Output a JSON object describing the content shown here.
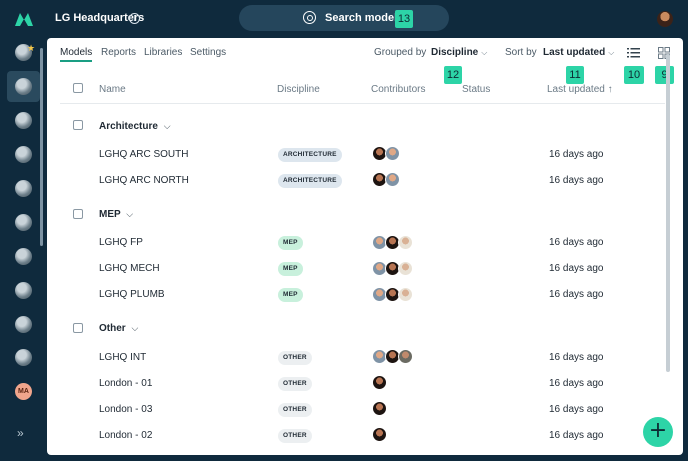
{
  "topbar": {
    "project_title": "LG Headquarters",
    "info_glyph": "i",
    "search_label": "Search models",
    "search_badge": "13"
  },
  "rail": {
    "user_initials": "MA",
    "expand_glyph": "»",
    "star_glyph": "★"
  },
  "tabs": [
    {
      "label": "Models",
      "active": true
    },
    {
      "label": "Reports",
      "active": false
    },
    {
      "label": "Libraries",
      "active": false
    },
    {
      "label": "Settings",
      "active": false
    }
  ],
  "toolbar": {
    "grouped_by_label": "Grouped by",
    "grouped_by_value": "Discipline",
    "grouped_by_badge": "12",
    "sort_by_label": "Sort by",
    "sort_by_value": "Last updated",
    "sort_by_badge": "11",
    "list_view_badge": "10",
    "grid_view_badge": "9",
    "chevron": "⌵"
  },
  "columns": {
    "name": "Name",
    "discipline": "Discipline",
    "contributors": "Contributors",
    "status": "Status",
    "last_updated": "Last updated",
    "sort_arrow": "↑"
  },
  "groups": [
    {
      "title": "Architecture",
      "rows": [
        {
          "name": "LGHQ ARC SOUTH",
          "discipline": "ARCHITECTURE",
          "updated": "16 days ago"
        },
        {
          "name": "LGHQ ARC NORTH",
          "discipline": "ARCHITECTURE",
          "updated": "16 days ago"
        }
      ]
    },
    {
      "title": "MEP",
      "rows": [
        {
          "name": "LGHQ FP",
          "discipline": "MEP",
          "updated": "16 days ago"
        },
        {
          "name": "LGHQ MECH",
          "discipline": "MEP",
          "updated": "16 days ago"
        },
        {
          "name": "LGHQ PLUMB",
          "discipline": "MEP",
          "updated": "16 days ago"
        }
      ]
    },
    {
      "title": "Other",
      "rows": [
        {
          "name": "LGHQ INT",
          "discipline": "OTHER",
          "updated": "16 days ago"
        },
        {
          "name": "London - 01",
          "discipline": "OTHER",
          "updated": "16 days ago"
        },
        {
          "name": "London - 03",
          "discipline": "OTHER",
          "updated": "16 days ago"
        },
        {
          "name": "London - 02",
          "discipline": "OTHER",
          "updated": "16 days ago"
        }
      ]
    }
  ],
  "fab_label": "+",
  "colors": {
    "app_background": "#0f2a3d",
    "accent": "#2dd4a7",
    "architecture_pill": "#dde6ee",
    "mep_pill": "#c8f0dc",
    "other_pill": "#eceff1"
  }
}
